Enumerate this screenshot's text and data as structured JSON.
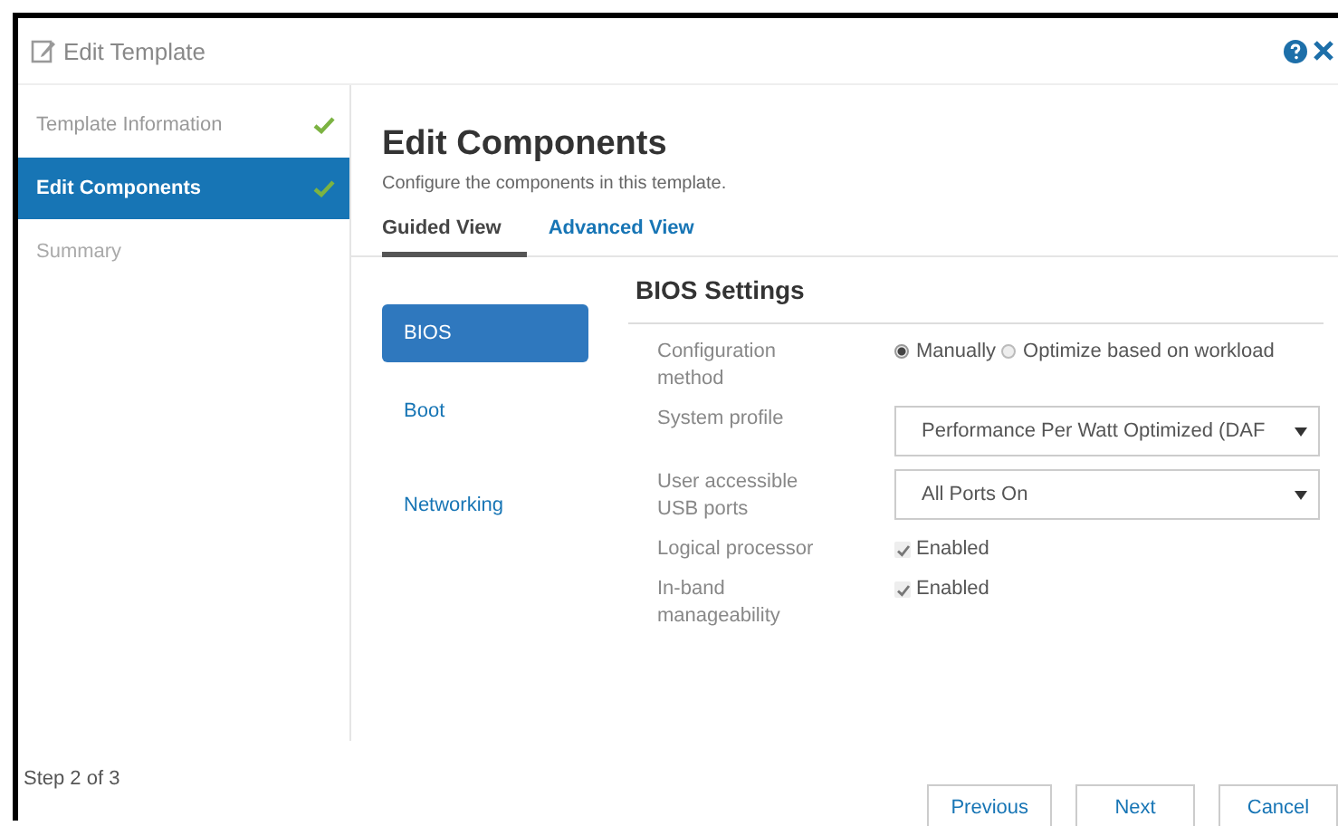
{
  "window": {
    "title": "Edit Template"
  },
  "steps": [
    {
      "label": "Template Information",
      "selected": false,
      "completed": true
    },
    {
      "label": "Edit Components",
      "selected": true,
      "completed": true
    },
    {
      "label": "Summary",
      "selected": false,
      "completed": false
    }
  ],
  "main": {
    "heading": "Edit Components",
    "subtitle": "Configure the components in this template."
  },
  "tabs": [
    {
      "label": "Guided View",
      "selected": true
    },
    {
      "label": "Advanced View",
      "selected": false
    }
  ],
  "components": [
    {
      "label": "BIOS",
      "selected": true
    },
    {
      "label": "Boot",
      "selected": false
    },
    {
      "label": "Networking",
      "selected": false
    }
  ],
  "section": {
    "title": "BIOS Settings"
  },
  "settings": [
    {
      "kind": "radio",
      "label": "Configuration method",
      "options": [
        {
          "label": "Manually",
          "selected": true
        },
        {
          "label": "Optimize based on workload",
          "selected": false
        }
      ]
    },
    {
      "kind": "select",
      "label": "System profile",
      "value": "Performance Per Watt Optimized (DAF"
    },
    {
      "kind": "select",
      "label": "User accessible USB ports",
      "value": "All Ports On"
    },
    {
      "kind": "checkbox",
      "label": "Logical processor",
      "option": "Enabled",
      "checked": true
    },
    {
      "kind": "checkbox",
      "label": "In-band manageability",
      "option": "Enabled",
      "checked": true
    }
  ],
  "status": "Step 2 of 3",
  "buttons": [
    "Previous",
    "Next",
    "Cancel"
  ]
}
